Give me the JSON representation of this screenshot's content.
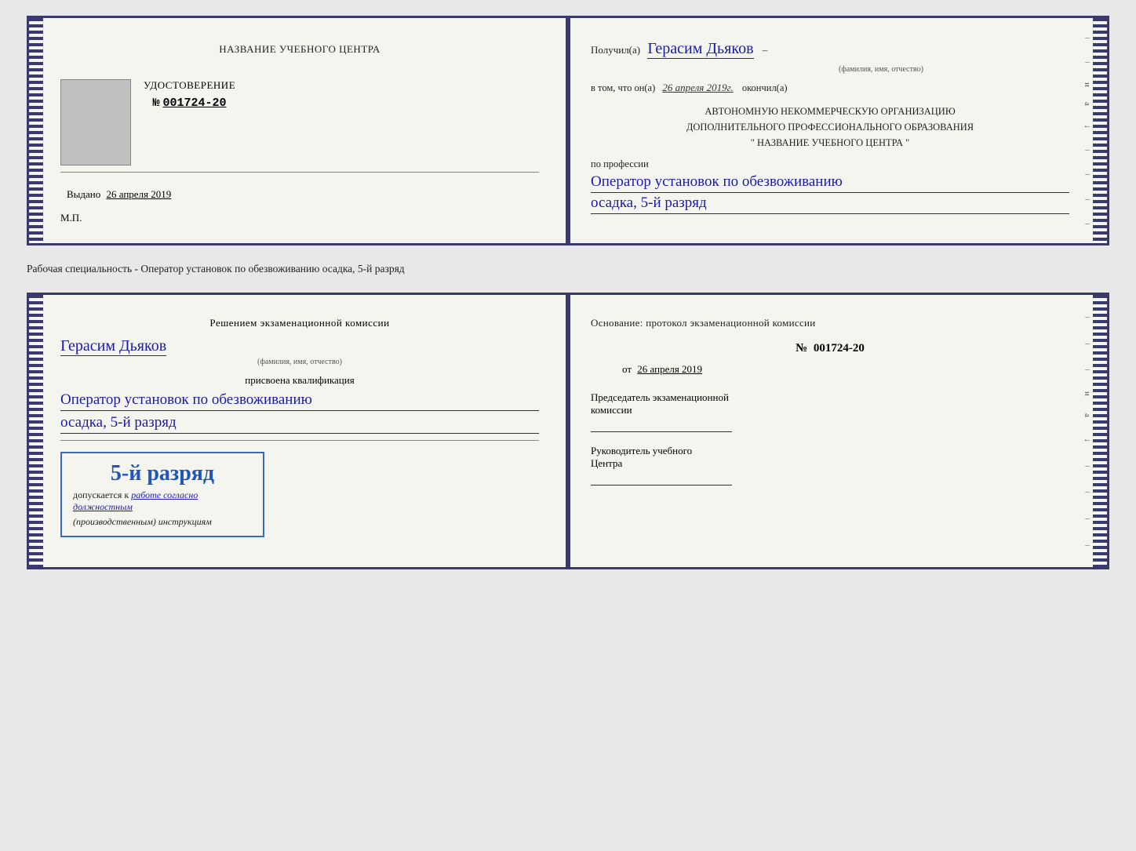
{
  "doc1": {
    "left": {
      "center_title": "НАЗВАНИЕ УЧЕБНОГО ЦЕНТРА",
      "cert_label": "УДОСТОВЕРЕНИЕ",
      "cert_number_prefix": "№",
      "cert_number": "001724-20",
      "issued_label": "Выдано",
      "issued_date": "26 апреля 2019",
      "mp_label": "М.П."
    },
    "right": {
      "received_prefix": "Получил(а)",
      "recipient_name": "Герасим Дьяков",
      "fio_label": "(фамилия, имя, отчество)",
      "in_that_prefix": "в том, что он(а)",
      "completion_date": "26 апреля 2019г.",
      "completed_suffix": "окончил(а)",
      "org_line1": "АВТОНОМНУЮ НЕКОММЕРЧЕСКУЮ ОРГАНИЗАЦИЮ",
      "org_line2": "ДОПОЛНИТЕЛЬНОГО ПРОФЕССИОНАЛЬНОГО ОБРАЗОВАНИЯ",
      "org_line3": "\"  НАЗВАНИЕ УЧЕБНОГО ЦЕНТРА  \"",
      "profession_prefix": "по профессии",
      "profession_hw1": "Оператор установок по обезвоживанию",
      "profession_hw2": "осадка, 5-й разряд"
    }
  },
  "separator": {
    "text": "Рабочая специальность - Оператор установок по обезвоживанию осадка, 5-й разряд"
  },
  "doc2": {
    "left": {
      "commission_text": "Решением экзаменационной комиссии",
      "person_name": "Герасим Дьяков",
      "fio_label": "(фамилия, имя, отчество)",
      "assigned_text": "присвоена квалификация",
      "qualification_hw1": "Оператор установок по обезвоживанию",
      "qualification_hw2": "осадка, 5-й разряд",
      "stamp_rank": "5-й разряд",
      "stamp_prefix": "допускается к",
      "stamp_hw": "работе согласно должностным",
      "stamp_italic": "(производственным) инструкциям"
    },
    "right": {
      "basis_text": "Основание: протокол экзаменационной комиссии",
      "protocol_prefix": "№",
      "protocol_number": "001724-20",
      "date_prefix": "от",
      "date_value": "26 апреля 2019",
      "chairman_line1": "Председатель экзаменационной",
      "chairman_line2": "комиссии",
      "director_line1": "Руководитель учебного",
      "director_line2": "Центра"
    }
  }
}
